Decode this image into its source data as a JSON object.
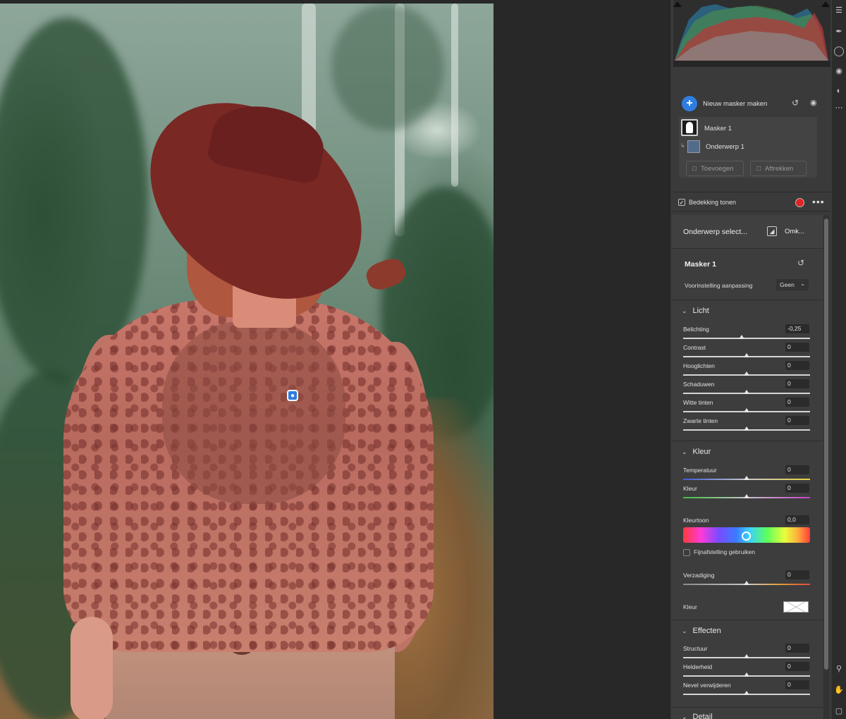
{
  "masks": {
    "new_mask_label": "Nieuw masker maken",
    "items": [
      {
        "label": "Masker 1"
      },
      {
        "label": "Onderwerp 1"
      }
    ],
    "add_button": "Toevoegen",
    "subtract_button": "Aftrekken"
  },
  "overlay": {
    "label": "Bedekking tonen",
    "checked": true,
    "color": "#e02323"
  },
  "selection": {
    "label": "Onderwerp select...",
    "invert_label": "Omk..."
  },
  "mask_panel": {
    "title": "Masker 1",
    "preset_label": "Voorinstelling aanpassing",
    "preset_value": "Geen"
  },
  "sections": {
    "light": {
      "title": "Licht",
      "sliders": [
        {
          "label": "Belichting",
          "value": "-0,25",
          "position": 0.46
        },
        {
          "label": "Contrast",
          "value": "0",
          "position": 0.5
        },
        {
          "label": "Hooglichten",
          "value": "0",
          "position": 0.5
        },
        {
          "label": "Schaduwen",
          "value": "0",
          "position": 0.5
        },
        {
          "label": "Witte tinten",
          "value": "0",
          "position": 0.5
        },
        {
          "label": "Zwarte tinten",
          "value": "0",
          "position": 0.5
        }
      ]
    },
    "color": {
      "title": "Kleur",
      "temperature": {
        "label": "Temperatuur",
        "value": "0",
        "position": 0.5
      },
      "tint": {
        "label": "Kleur",
        "value": "0",
        "position": 0.5
      },
      "hue": {
        "label": "Kleurtoon",
        "value": "0,0",
        "position": 0.5
      },
      "fine_tune_label": "Fijnafstelling gebruiken",
      "saturation": {
        "label": "Verzadiging",
        "value": "0",
        "position": 0.5
      },
      "color_label": "Kleur"
    },
    "effects": {
      "title": "Effecten",
      "sliders": [
        {
          "label": "Structuur",
          "value": "0",
          "position": 0.5
        },
        {
          "label": "Helderheid",
          "value": "0",
          "position": 0.5
        },
        {
          "label": "Nevel verwijderen",
          "value": "0",
          "position": 0.5
        }
      ]
    },
    "detail": {
      "title": "Detail"
    }
  },
  "colors": {
    "accent": "#2f7de0",
    "panel_bg": "#3d3d3d",
    "overlay_red": "#e02323"
  },
  "icons": [
    "plus-icon",
    "reset-icon",
    "eye-icon",
    "mask-icon",
    "subject-icon",
    "more-icon",
    "invert-icon",
    "chevron-down-icon",
    "tool-icon",
    "hand-icon"
  ]
}
